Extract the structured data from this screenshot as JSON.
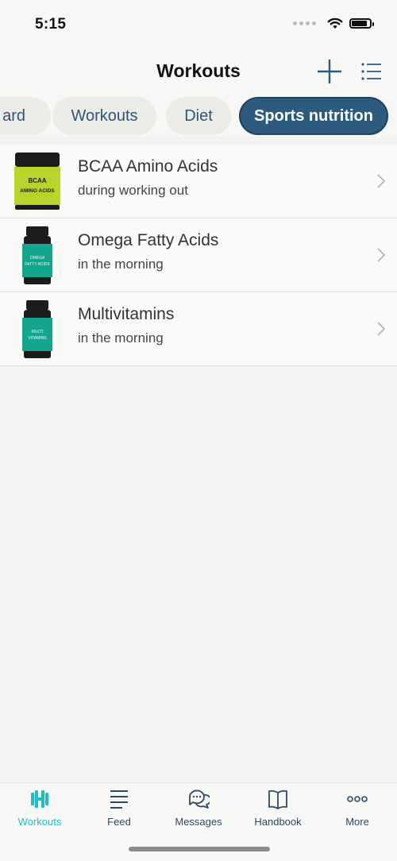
{
  "status_bar": {
    "time": "5:15",
    "icons": [
      "cellular-dots-icon",
      "wifi-icon",
      "battery-icon"
    ],
    "battery_level": 0.85
  },
  "nav_bar": {
    "title": "Workouts",
    "actions": [
      "plus-icon",
      "list-icon"
    ]
  },
  "filter_tabs": [
    {
      "label": "ard",
      "active": false
    },
    {
      "label": "Workouts",
      "active": false
    },
    {
      "label": "Diet",
      "active": false
    },
    {
      "label": "Sports nutrition",
      "active": true
    }
  ],
  "items": [
    {
      "title": "BCAA Amino Acids",
      "subtitle": "during working out",
      "image_label": "BCAA AMINO ACIDS",
      "image_color": "#b8d32a"
    },
    {
      "title": "Omega Fatty Acids",
      "subtitle": "in the morning",
      "image_label": "OMEGA FATTY ACIDS",
      "image_color": "#12a58c"
    },
    {
      "title": "Multivitamins",
      "subtitle": "in the morning",
      "image_label": "MULTI VITAMINS",
      "image_color": "#14a58e"
    }
  ],
  "tab_bar": [
    {
      "label": "Workouts",
      "icon": "dumbbell-icon",
      "active": true
    },
    {
      "label": "Feed",
      "icon": "feed-lines-icon",
      "active": false
    },
    {
      "label": "Messages",
      "icon": "chat-bubbles-icon",
      "active": false
    },
    {
      "label": "Handbook",
      "icon": "book-icon",
      "active": false
    },
    {
      "label": "More",
      "icon": "more-dots-icon",
      "active": false
    }
  ],
  "colors": {
    "accent": "#1dbec8",
    "brand": "#2d5b7e",
    "background": "#f3f4f1"
  }
}
